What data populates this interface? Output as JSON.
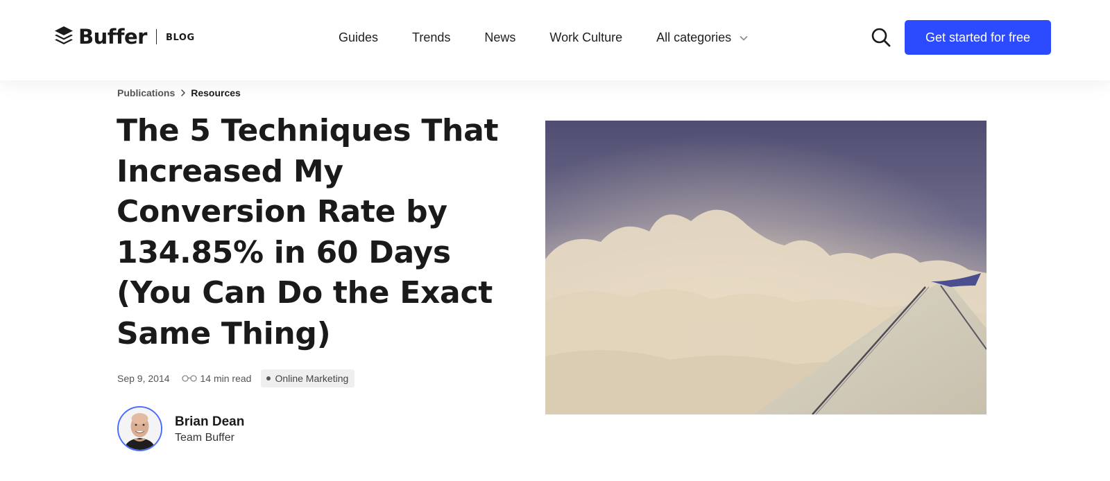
{
  "header": {
    "logo_word": "Buffer",
    "logo_section": "BLOG",
    "nav": [
      {
        "label": "Guides"
      },
      {
        "label": "Trends"
      },
      {
        "label": "News"
      },
      {
        "label": "Work Culture"
      },
      {
        "label": "All categories"
      }
    ],
    "cta_label": "Get started for free",
    "search_icon": "search-icon",
    "dropdown_icon": "chevron-down-icon"
  },
  "breadcrumb": {
    "items": [
      "Publications",
      "Resources"
    ],
    "separator_icon": "chevron-right-icon"
  },
  "article": {
    "title": "The 5 Techniques That Increased My Conversion Rate by 134.85% in 60 Days (You Can Do the Exact Same Thing)",
    "date": "Sep 9, 2014",
    "read_time": "14 min read",
    "read_icon": "glasses-icon",
    "category": "Online Marketing",
    "author": {
      "name": "Brian Dean",
      "team": "Team Buffer"
    },
    "hero_image": "airplane-wing-above-clouds"
  },
  "colors": {
    "accent": "#2c4bff",
    "text": "#1a1a1a",
    "muted": "#555555",
    "tag_bg": "#efefef",
    "avatar_ring": "#4a6bff"
  }
}
